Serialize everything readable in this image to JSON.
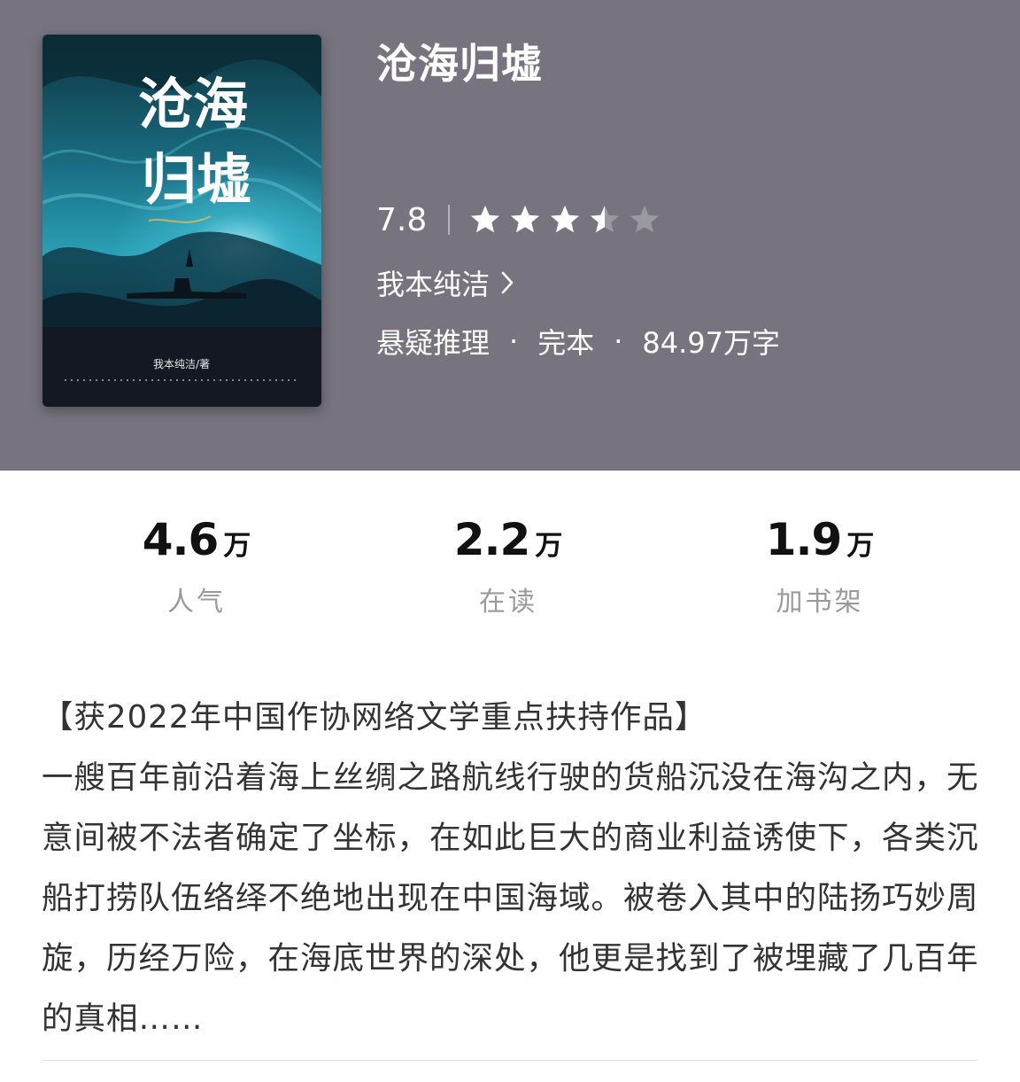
{
  "book": {
    "title": "沧海归墟",
    "score": "7.8",
    "stars_value": 3.5,
    "stars_max": 5,
    "author_link": "我本纯洁",
    "genre": "悬疑推理",
    "separator": "·",
    "status": "完本",
    "word_count": "84.97万字"
  },
  "cover": {
    "title_line1": "沧海",
    "title_line2": "归墟",
    "byline": "我本纯洁/著",
    "colors": {
      "deep": "#0c2d38",
      "mid": "#1d6f86",
      "glow": "#3fc6dc",
      "dark": "#151820"
    }
  },
  "stats": [
    {
      "value": "4.6",
      "unit": "万",
      "label": "人气"
    },
    {
      "value": "2.2",
      "unit": "万",
      "label": "在读"
    },
    {
      "value": "1.9",
      "unit": "万",
      "label": "加书架"
    }
  ],
  "description": {
    "headline": "【获2022年中国作协网络文学重点扶持作品】",
    "body": "一艘百年前沿着海上丝绸之路航线行驶的货船沉没在海沟之内，无意间被不法者确定了坐标，在如此巨大的商业利益诱使下，各类沉船打捞队伍络绎不绝地出现在中国海域。被卷入其中的陆扬巧妙周旋，历经万险，在海底世界的深处，他更是找到了被埋藏了几百年的真相……"
  },
  "theme": {
    "header_bg": "#77747f",
    "star_filled": "#ffffff",
    "star_empty": "#9a98a1"
  }
}
